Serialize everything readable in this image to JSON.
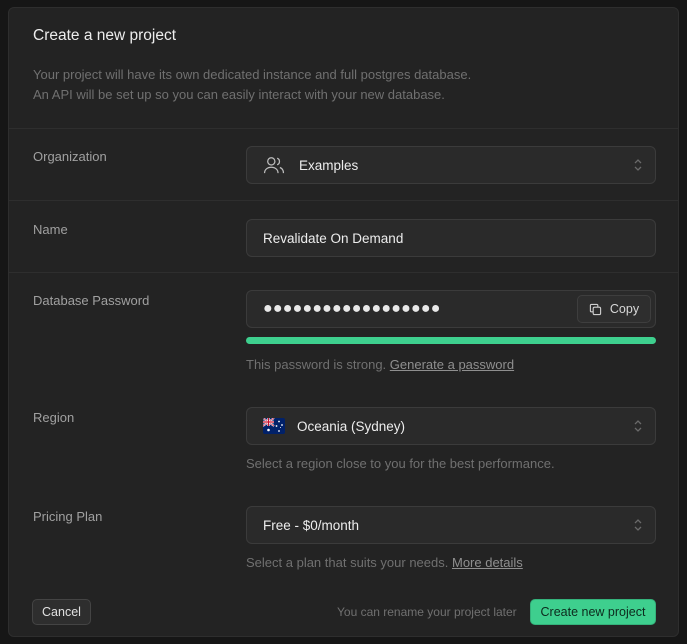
{
  "dialog": {
    "title": "Create a new project",
    "description_line1": "Your project will have its own dedicated instance and full postgres database.",
    "description_line2": "An API will be set up so you can easily interact with your new database."
  },
  "organization": {
    "label": "Organization",
    "value": "Examples",
    "icon": "users-icon"
  },
  "name": {
    "label": "Name",
    "value": "Revalidate On Demand"
  },
  "password": {
    "label": "Database Password",
    "value": "●●●●●●●●●●●●●●●●●●",
    "copy_label": "Copy",
    "strength_text": "This password is strong.",
    "generate_link": "Generate a password",
    "strength": 1.0,
    "strength_color": "#3ecf8e"
  },
  "region": {
    "label": "Region",
    "value": "Oceania (Sydney)",
    "icon": "australia-flag-icon",
    "help": "Select a region close to you for the best performance."
  },
  "plan": {
    "label": "Pricing Plan",
    "value": "Free - $0/month",
    "help": "Select a plan that suits your needs.",
    "details_link": "More details"
  },
  "footer": {
    "cancel_label": "Cancel",
    "rename_note": "You can rename your project later",
    "create_label": "Create new project"
  },
  "colors": {
    "background": "#161616",
    "panel": "#232323",
    "accent": "#3ecf8e"
  }
}
